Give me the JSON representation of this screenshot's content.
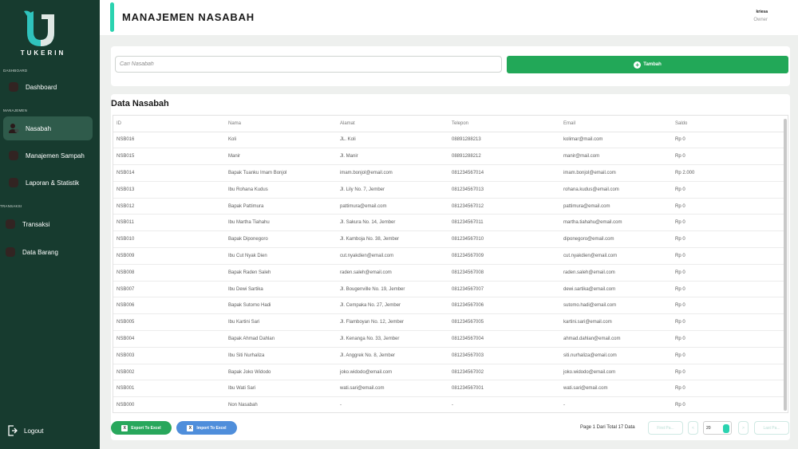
{
  "app": {
    "brand": "TUKERIN"
  },
  "sidebar": {
    "sections": {
      "dashboard": "DASHBOARD",
      "manajemen": "MANAJEMEN",
      "transaksi": "TRANSAKSI"
    },
    "items": [
      {
        "label": "Dashboard",
        "icon": "dashboard-icon"
      },
      {
        "label": "Nasabah",
        "icon": "users-icon",
        "active": true
      },
      {
        "label": "Manajemen Sampah",
        "icon": "trash-icon"
      },
      {
        "label": "Laporan & Statistik",
        "icon": "chart-icon"
      },
      {
        "label": "Transaksi",
        "icon": "transaction-icon"
      },
      {
        "label": "Data Barang",
        "icon": "box-icon"
      }
    ],
    "logout": "Logout"
  },
  "header": {
    "title": "MANAJEMEN NASABAH",
    "user_name": "kriesa",
    "user_role": "Owner",
    "accent_color": "#2bd3b0"
  },
  "search": {
    "placeholder": "Cari Nasabah",
    "add_label": "Tambah",
    "add_color": "#22a858"
  },
  "table": {
    "title": "Data Nasabah",
    "columns": [
      "ID",
      "Nama",
      "Alamat",
      "Telepon",
      "Email",
      "Saldo"
    ],
    "rows": [
      [
        "NSB016",
        "Koli",
        "JL. Koli",
        "08891288213",
        "kolimar@mail.com",
        "Rp 0"
      ],
      [
        "NSB015",
        "Manir",
        "Jl. Manir",
        "08891288212",
        "manir@mail.com",
        "Rp 0"
      ],
      [
        "NSB014",
        "Bapak Tuanku Imam Bonjol",
        "imam.bonjol@email.com",
        "081234567014",
        "imam.bonjol@email.com",
        "Rp 2.000"
      ],
      [
        "NSB013",
        "Ibu Rohana Kudus",
        "Jl. Lily No. 7, Jember",
        "081234567013",
        "rohana.kudus@email.com",
        "Rp 0"
      ],
      [
        "NSB012",
        "Bapak Pattimura",
        "pattimura@email.com",
        "081234567012",
        "pattimura@email.com",
        "Rp 0"
      ],
      [
        "NSB011",
        "Ibu Martha Tiahahu",
        "Jl. Sakura No. 14, Jember",
        "081234567011",
        "martha.tiahahu@email.com",
        "Rp 0"
      ],
      [
        "NSB010",
        "Bapak Diponegoro",
        "Jl. Kamboja No. 38, Jember",
        "081234567010",
        "diponegoro@email.com",
        "Rp 0"
      ],
      [
        "NSB009",
        "Ibu Cut Nyak Dien",
        "cut.nyakdien@email.com",
        "081234567009",
        "cut.nyakdien@email.com",
        "Rp 0"
      ],
      [
        "NSB008",
        "Bapak Raden Saleh",
        "raden.saleh@email.com",
        "081234567008",
        "raden.saleh@email.com",
        "Rp 0"
      ],
      [
        "NSB007",
        "Ibu Dewi Sartika",
        "Jl. Bougenville No. 19, Jember",
        "081234567007",
        "dewi.sartika@email.com",
        "Rp 0"
      ],
      [
        "NSB006",
        "Bapak Sutomo Hadi",
        "Jl. Cempaka No. 27, Jember",
        "081234567006",
        "sutomo.hadi@email.com",
        "Rp 0"
      ],
      [
        "NSB005",
        "Ibu Kartini Sari",
        "Jl. Flamboyan No. 12, Jember",
        "081234567005",
        "kartini.sari@email.com",
        "Rp 0"
      ],
      [
        "NSB004",
        "Bapak Ahmad Dahlan",
        "Jl. Kenanga No. 33, Jember",
        "081234567004",
        "ahmad.dahlan@email.com",
        "Rp 0"
      ],
      [
        "NSB003",
        "Ibu Siti Nurhaliza",
        "Jl. Anggrek No. 8, Jember",
        "081234567003",
        "siti.nurhaliza@email.com",
        "Rp 0"
      ],
      [
        "NSB002",
        "Bapak Joko Widodo",
        "joko.widodo@email.com",
        "081234567002",
        "joko.widodo@email.com",
        "Rp 0"
      ],
      [
        "NSB001",
        "Ibu Wati Sari",
        "wati.sari@email.com",
        "081234567001",
        "wati.sari@email.com",
        "Rp 0"
      ],
      [
        "NSB000",
        "Non Nasabah",
        "-",
        "-",
        "-",
        "Rp 0"
      ]
    ]
  },
  "footer": {
    "export_label": "Export To Excel",
    "import_label": "Import To Excel",
    "page_info": "Page 1 Dari Total 17 Data",
    "first_page": "First Pa...",
    "prev": "<",
    "page_size": "20",
    "next": ">",
    "last_page": "Last Pa..."
  }
}
